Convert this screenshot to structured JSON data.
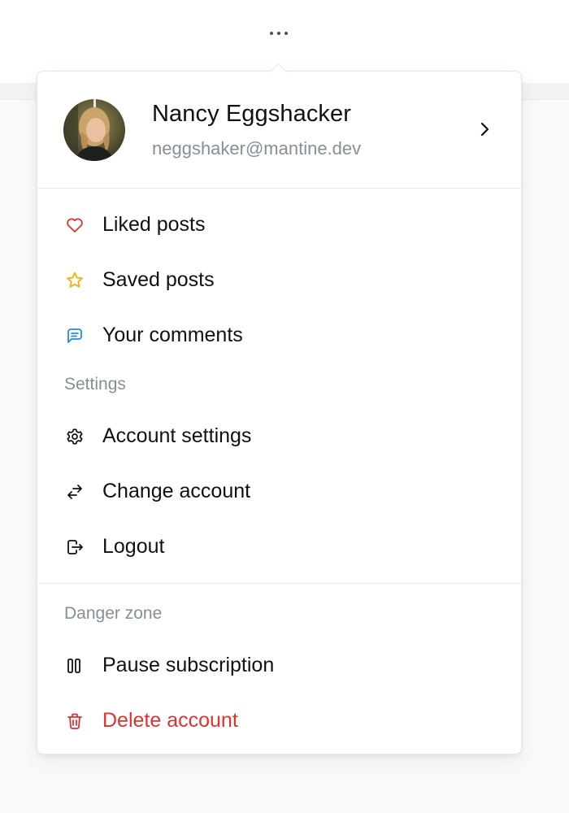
{
  "trigger": {
    "icon": "dots-horizontal-icon"
  },
  "profile": {
    "name": "Nancy Eggshacker",
    "email": "neggshaker@mantine.dev",
    "avatar_icon": "user-avatar-photo",
    "chevron_icon": "chevron-right-icon"
  },
  "main_items": [
    {
      "label": "Liked posts",
      "icon": "heart-icon",
      "icon_color": "#e03131"
    },
    {
      "label": "Saved posts",
      "icon": "star-icon",
      "icon_color": "#fab005"
    },
    {
      "label": "Your comments",
      "icon": "message-icon",
      "icon_color": "#228be6"
    }
  ],
  "settings": {
    "section_label": "Settings",
    "items": [
      {
        "label": "Account settings",
        "icon": "gear-icon"
      },
      {
        "label": "Change account",
        "icon": "switch-arrows-icon"
      },
      {
        "label": "Logout",
        "icon": "logout-icon"
      }
    ]
  },
  "danger": {
    "section_label": "Danger zone",
    "items": [
      {
        "label": "Pause subscription",
        "icon": "pause-icon"
      },
      {
        "label": "Delete account",
        "icon": "trash-icon",
        "color": "#e03131"
      }
    ]
  },
  "colors": {
    "text": "#111111",
    "muted": "#868e96",
    "danger": "#e03131",
    "divider": "#e9ecef"
  }
}
